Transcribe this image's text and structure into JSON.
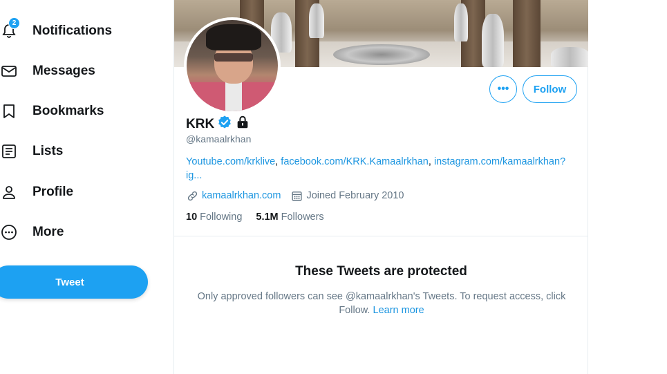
{
  "sidebar": {
    "notifications_badge": "2",
    "items": [
      {
        "label": "Notifications",
        "icon": "bell-icon"
      },
      {
        "label": "Messages",
        "icon": "envelope-icon"
      },
      {
        "label": "Bookmarks",
        "icon": "bookmark-icon"
      },
      {
        "label": "Lists",
        "icon": "list-icon"
      },
      {
        "label": "Profile",
        "icon": "person-icon"
      },
      {
        "label": "More",
        "icon": "more-circle-icon"
      }
    ],
    "tweet_label": "Tweet"
  },
  "profile": {
    "more_label": "•••",
    "follow_label": "Follow",
    "name": "KRK",
    "handle": "@kamaalrkhan",
    "bio_links": [
      "Youtube.com/krklive",
      "facebook.com/KRK.Kamaalrkhan",
      "instagram.com/kamaalrkhan?ig..."
    ],
    "bio_sep": ", ",
    "website": "kamaalrkhan.com",
    "joined": "Joined February 2010",
    "following_count": "10",
    "following_label": "Following",
    "followers_count": "5.1M",
    "followers_label": "Followers"
  },
  "protected": {
    "title": "These Tweets are protected",
    "text": "Only approved followers can see @kamaalrkhan's Tweets. To request access, click Follow.",
    "learn_more": "Learn more"
  },
  "colors": {
    "accent": "#1da1f2",
    "link": "#1b95e0",
    "secondary_text": "#657786"
  }
}
